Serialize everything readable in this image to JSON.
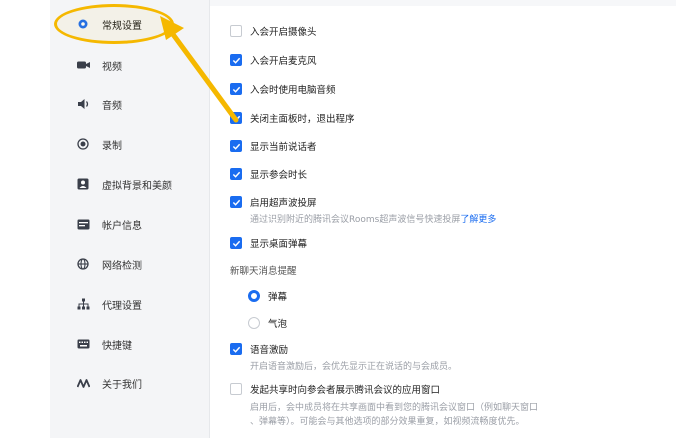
{
  "sidebar": {
    "items": [
      {
        "label": "常规设置",
        "icon": "gear-icon"
      },
      {
        "label": "视频",
        "icon": "camera-icon"
      },
      {
        "label": "音频",
        "icon": "speaker-icon"
      },
      {
        "label": "录制",
        "icon": "record-icon"
      },
      {
        "label": "虚拟背景和美颜",
        "icon": "portrait-icon"
      },
      {
        "label": "帐户信息",
        "icon": "id-card-icon"
      },
      {
        "label": "网络检测",
        "icon": "globe-icon"
      },
      {
        "label": "代理设置",
        "icon": "network-tree-icon"
      },
      {
        "label": "快捷键",
        "icon": "keyboard-icon"
      },
      {
        "label": "关于我们",
        "icon": "logo-icon"
      }
    ],
    "active_index": 0
  },
  "settings": {
    "open_camera": {
      "label": "入会开启摄像头",
      "checked": false
    },
    "open_mic": {
      "label": "入会开启麦克风",
      "checked": true
    },
    "use_pc_audio": {
      "label": "入会时使用电脑音频",
      "checked": true
    },
    "exit_on_close": {
      "label": "关闭主面板时，退出程序",
      "checked": true
    },
    "show_speaker": {
      "label": "显示当前说话者",
      "checked": true
    },
    "show_duration": {
      "label": "显示参会时长",
      "checked": true
    },
    "ultrasonic": {
      "label": "启用超声波投屏",
      "checked": true,
      "desc_prefix": "通过识别附近的腾讯会议Rooms超声波信号快速投屏",
      "desc_link": "了解更多"
    },
    "show_danmaku": {
      "label": "显示桌面弹幕",
      "checked": true
    },
    "chat_alert": {
      "title": "新聊天消息提醒",
      "options": [
        {
          "label": "弹幕",
          "selected": true
        },
        {
          "label": "气泡",
          "selected": false
        }
      ]
    },
    "voice_motivation": {
      "label": "语音激励",
      "checked": true,
      "desc": "开启语音激励后，会优先显示正在说话的与会成员。"
    },
    "share_app_window": {
      "label": "发起共享时向参会者展示腾讯会议的应用窗口",
      "checked": false,
      "desc_line1": "启用后，会中成员将在共享画面中看到您的腾讯会议窗口（例如聊天窗口",
      "desc_line2": "、弹幕等）。可能会与其他选项的部分效果重复，如视频流畅度优先。"
    }
  },
  "colors": {
    "accent": "#1a6cf0",
    "highlight": "#f5b800"
  }
}
